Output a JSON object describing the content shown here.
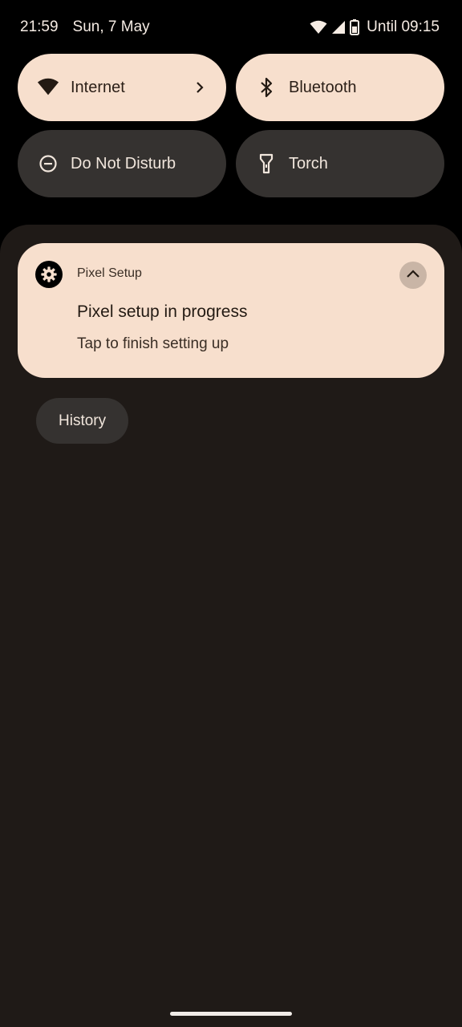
{
  "status_bar": {
    "time": "21:59",
    "date": "Sun, 7 May",
    "battery_text": "Until 09:15",
    "icons": [
      "wifi-icon",
      "cellular-signal-icon",
      "battery-icon"
    ]
  },
  "quick_settings": {
    "tiles": [
      {
        "label": "Internet",
        "icon": "wifi-icon",
        "state": "on",
        "has_chevron": true
      },
      {
        "label": "Bluetooth",
        "icon": "bluetooth-icon",
        "state": "on"
      },
      {
        "label": "Do Not Disturb",
        "icon": "do-not-disturb-icon",
        "state": "off"
      },
      {
        "label": "Torch",
        "icon": "torch-icon",
        "state": "off"
      }
    ]
  },
  "notification": {
    "app_name": "Pixel Setup",
    "app_icon": "gear-icon",
    "title": "Pixel setup in progress",
    "text": "Tap to finish setting up",
    "expand_icon": "chevron-up-icon"
  },
  "history_button": {
    "label": "History"
  },
  "colors": {
    "tile_on": "#f7dfcd",
    "tile_off": "#353230",
    "shade_bg": "#1f1a17",
    "background": "#000000"
  }
}
